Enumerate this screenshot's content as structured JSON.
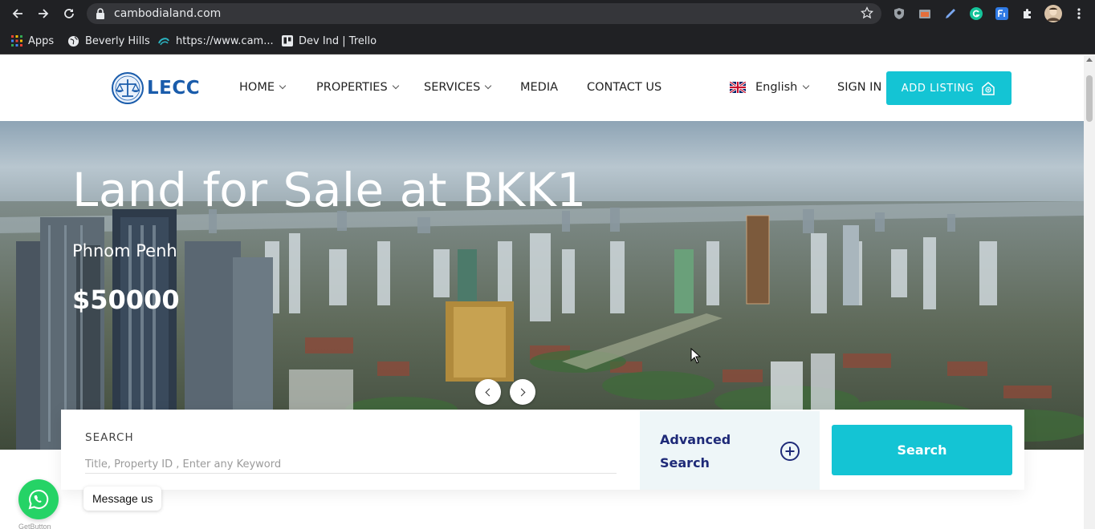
{
  "browser": {
    "url": "cambodialand.com",
    "bookmarks": [
      {
        "label": "Apps",
        "icon": "apps-grid-icon"
      },
      {
        "label": "Beverly Hills",
        "icon": "globe-icon"
      },
      {
        "label": "https://www.cam...",
        "icon": "site-icon"
      },
      {
        "label": "Dev Ind | Trello",
        "icon": "trello-icon"
      }
    ]
  },
  "site": {
    "logo_text": "LECC",
    "nav": [
      {
        "label": "HOME",
        "dropdown": true
      },
      {
        "label": "PROPERTIES",
        "dropdown": true
      },
      {
        "label": "SERVICES",
        "dropdown": true
      },
      {
        "label": "MEDIA",
        "dropdown": false
      },
      {
        "label": "CONTACT US",
        "dropdown": false
      }
    ],
    "language": "English",
    "sign_in": "SIGN IN",
    "add_listing": "ADD LISTING",
    "accent_color": "#14c4d4",
    "navy_color": "#1e2a78"
  },
  "hero": {
    "title": "Land for Sale at BKK1",
    "location": "Phnom Penh",
    "price": "$50000"
  },
  "search": {
    "label": "SEARCH",
    "placeholder": "Title, Property ID , Enter any Keyword",
    "advanced_label": "Advanced Search",
    "button": "Search"
  },
  "widget": {
    "message": "Message us",
    "credit": "GetButton"
  }
}
